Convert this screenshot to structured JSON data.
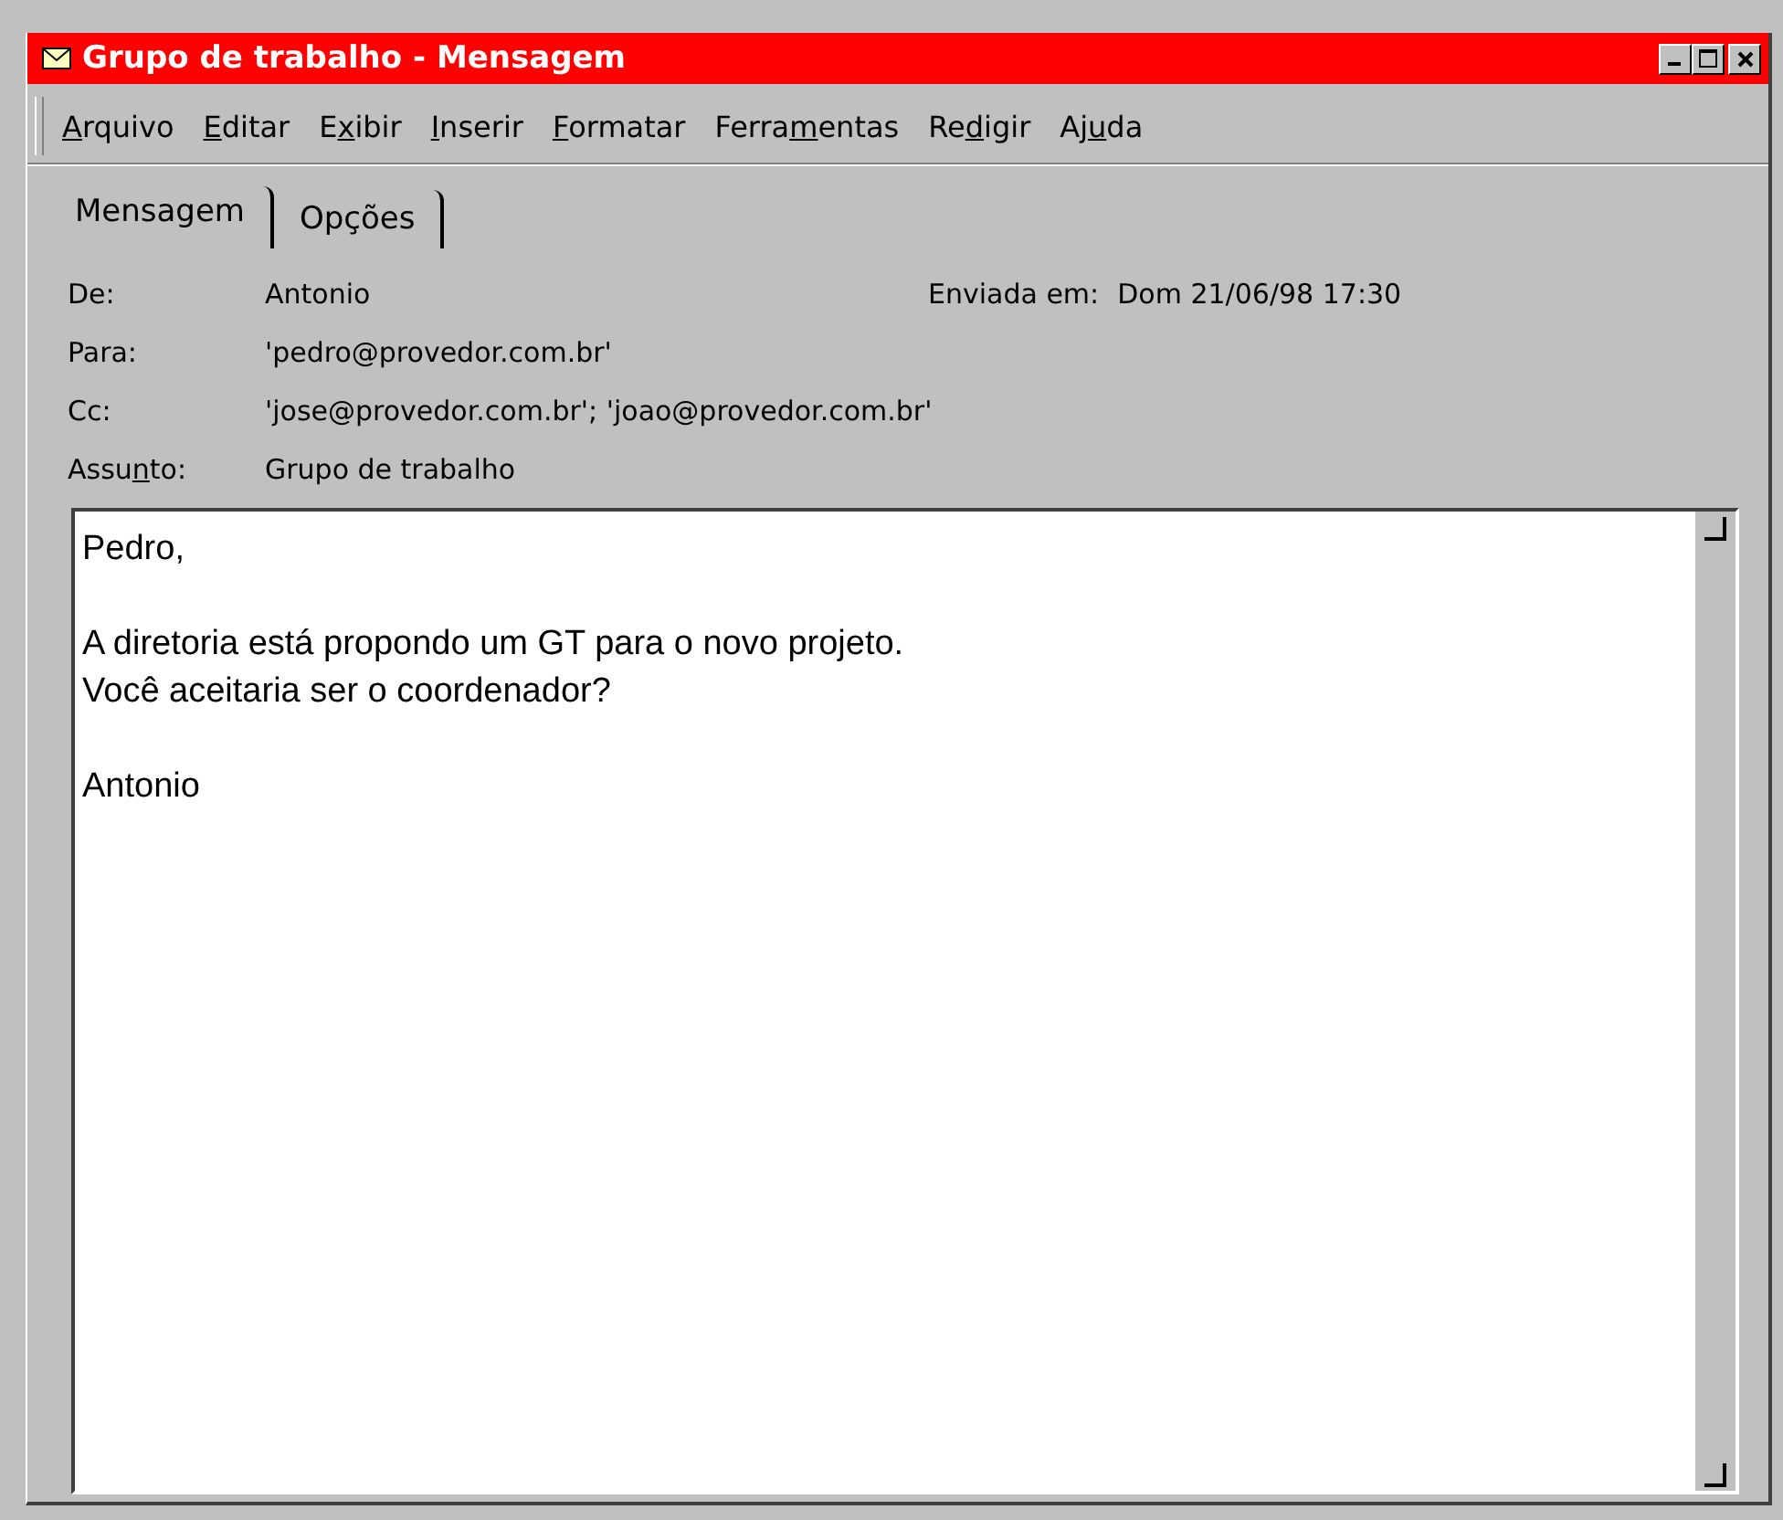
{
  "window": {
    "title": "Grupo de trabalho - Mensagem"
  },
  "menu": [
    {
      "key": "A",
      "post": "rquivo"
    },
    {
      "key": "E",
      "post": "ditar"
    },
    {
      "pre": "E",
      "key": "x",
      "post": "ibir"
    },
    {
      "key": "I",
      "post": "nserir"
    },
    {
      "key": "F",
      "post": "ormatar"
    },
    {
      "pre": "Ferra",
      "key": "m",
      "post": "entas"
    },
    {
      "pre": "Re",
      "key": "d",
      "post": "igir"
    },
    {
      "pre": "Aj",
      "key": "u",
      "post": "da"
    }
  ],
  "tabs": [
    {
      "label": "Mensagem",
      "selected": true
    },
    {
      "label": "Opções",
      "selected": false
    }
  ],
  "header": {
    "from": {
      "label": "De:",
      "value": "Antonio"
    },
    "sent": {
      "label": "Enviada em:",
      "value": "Dom 21/06/98 17:30"
    },
    "to": {
      "label": "Para:",
      "value": "'pedro@provedor.com.br'"
    },
    "cc": {
      "label": "Cc:",
      "value": "'jose@provedor.com.br'; 'joao@provedor.com.br'"
    },
    "subject": {
      "label": {
        "pre": "Assu",
        "key": "n",
        "post": "to:"
      },
      "value": "Grupo de trabalho"
    }
  },
  "body": [
    [
      "Pedro,"
    ],
    [
      "A diretoria está propondo um GT para o novo projeto.",
      "Você aceitaria ser o coordenador?"
    ],
    [
      "Antonio"
    ]
  ]
}
